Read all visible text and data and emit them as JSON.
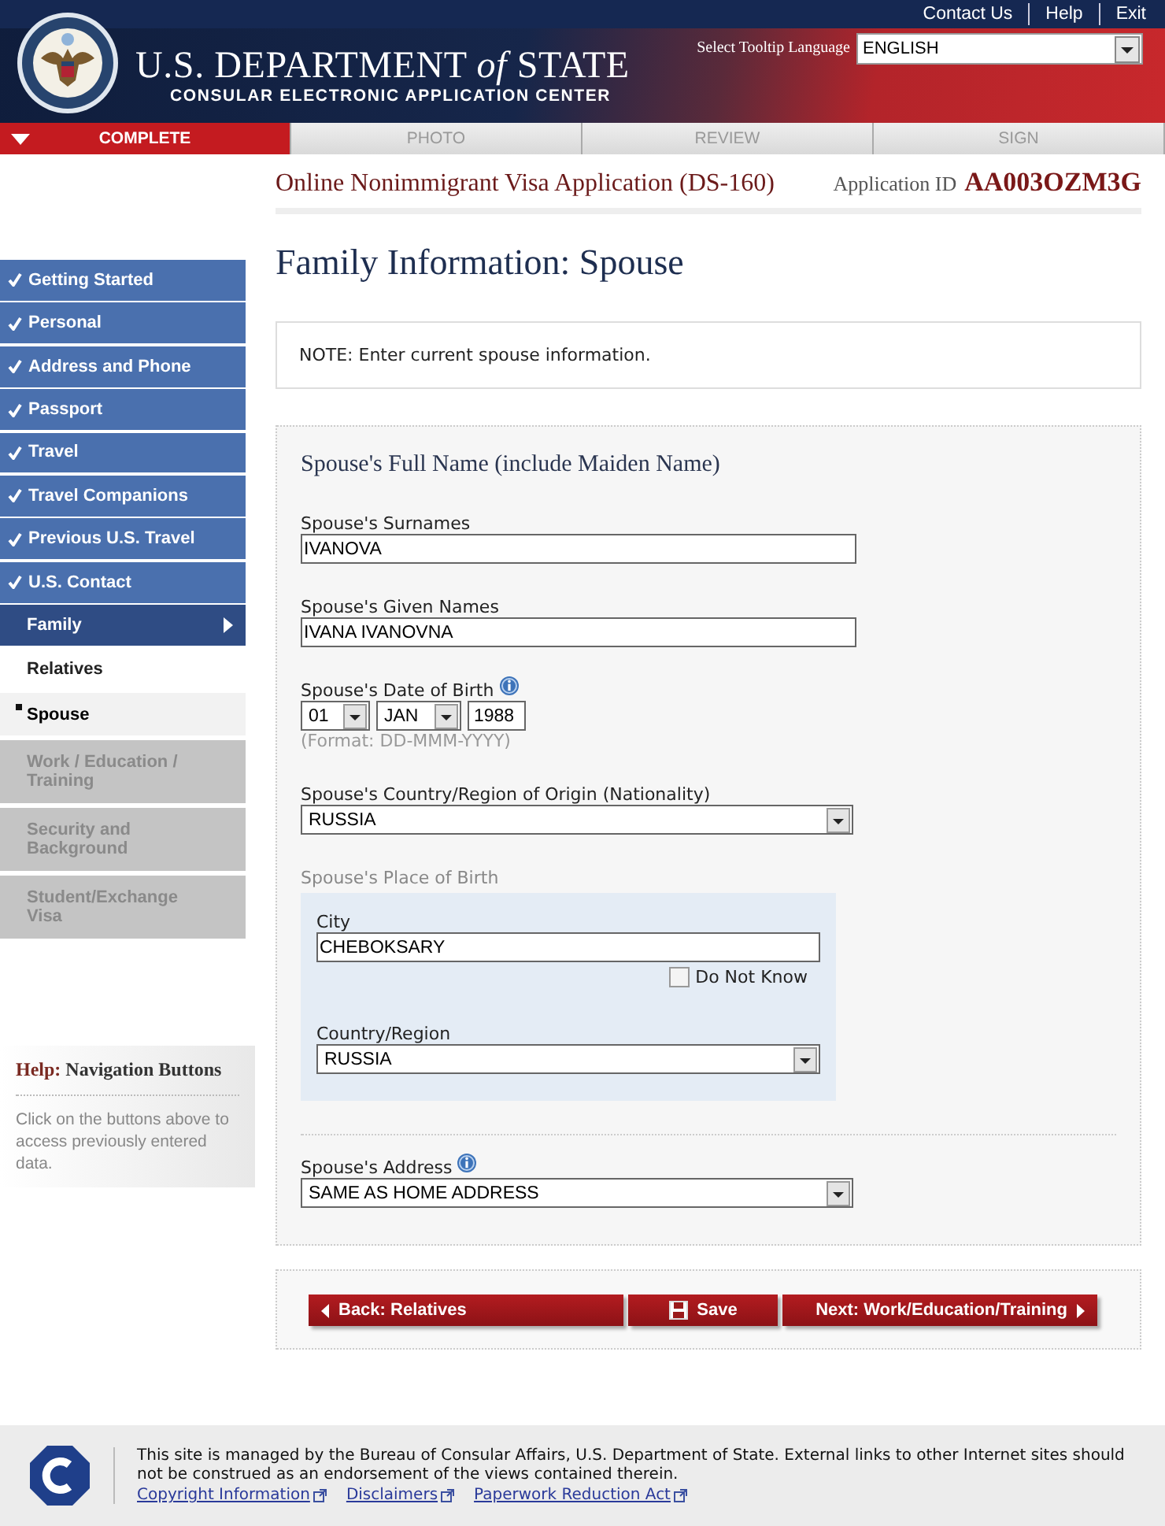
{
  "top_links": [
    {
      "label": "Contact Us"
    },
    {
      "label": "Help"
    },
    {
      "label": "Exit"
    }
  ],
  "header": {
    "title": "U.S. DEPARTMENT *of* STATE",
    "subtitle": "CONSULAR ELECTRONIC APPLICATION CENTER",
    "tooltip_language": {
      "label": "Select Tooltip Language",
      "value": "ENGLISH"
    }
  },
  "progress_tabs": [
    {
      "label": "COMPLETE",
      "selected": true
    },
    {
      "label": "PHOTO",
      "selected": false
    },
    {
      "label": "REVIEW",
      "selected": false
    },
    {
      "label": "SIGN",
      "selected": false
    }
  ],
  "application": {
    "title": "Online Nonimmigrant Visa Application (DS-160)",
    "id_label": "Application ID",
    "id": "AA003OZM3G"
  },
  "sidebar": {
    "items": [
      {
        "label": "Getting Started",
        "kind": "completed",
        "selected": false
      },
      {
        "label": "Personal",
        "kind": "completed",
        "selected": false
      },
      {
        "label": "Address and Phone",
        "kind": "completed",
        "selected": false
      },
      {
        "label": "Passport",
        "kind": "completed",
        "selected": false
      },
      {
        "label": "Travel",
        "kind": "completed",
        "selected": false
      },
      {
        "label": "Travel Companions",
        "kind": "completed",
        "selected": false
      },
      {
        "label": "Previous U.S. Travel",
        "kind": "completed",
        "selected": false
      },
      {
        "label": "U.S. Contact",
        "kind": "completed",
        "selected": false
      },
      {
        "label": "Family",
        "kind": "section",
        "selected": true
      },
      {
        "label": "Relatives",
        "kind": "subsection",
        "selected": false
      },
      {
        "label": "Spouse",
        "kind": "subsection",
        "selected": true
      },
      {
        "label": "Work / Education / Training",
        "kind": "pending",
        "selected": false
      },
      {
        "label": "Security and Background",
        "kind": "pending",
        "selected": false
      },
      {
        "label": "Student/Exchange Visa",
        "kind": "pending",
        "selected": false
      }
    ],
    "help": {
      "prefix": "Help:",
      "title": "Navigation Buttons",
      "text": "Click on the buttons above to access previously entered data."
    }
  },
  "page_title": "Family Information: Spouse",
  "note": "NOTE: Enter current spouse information.",
  "form": {
    "section_title": "Spouse's Full Name (include Maiden Name)",
    "fields": [
      {
        "kind": "text",
        "label": "Spouse's Surnames",
        "value": "IVANOVA"
      },
      {
        "kind": "text",
        "label": "Spouse's Given Names",
        "value": "IVANA IVANOVNA"
      },
      {
        "kind": "date",
        "label": "Spouse's Date of Birth",
        "info": true,
        "day": "01",
        "month": "JAN",
        "year": "1988",
        "hint": "(Format: DD-MMM-YYYY)"
      },
      {
        "kind": "select",
        "label": "Spouse's Country/Region of Origin (Nationality)",
        "info": false,
        "value": "RUSSIA"
      },
      {
        "kind": "group",
        "label": "Spouse's Place of Birth",
        "city_label": "City",
        "city": "CHEBOKSARY",
        "do_not_know": {
          "label": "Do Not Know",
          "checked": false
        },
        "country_label": "Country/Region",
        "country": "RUSSIA"
      },
      {
        "kind": "divider"
      },
      {
        "kind": "select",
        "label": "Spouse's Address",
        "info": true,
        "value": "SAME AS HOME ADDRESS"
      }
    ]
  },
  "buttons": [
    {
      "kind": "back",
      "label": "Back: Relatives"
    },
    {
      "kind": "save",
      "label": "Save"
    },
    {
      "kind": "next",
      "label": "Next: Work/Education/Training"
    }
  ],
  "footer": {
    "text": "This site is managed by the Bureau of Consular Affairs, U.S. Department of State. External links to other Internet sites should not be construed as an endorsement of the views contained therein.",
    "links": [
      "Copyright Information",
      "Disclaimers",
      "Paperwork Reduction Act"
    ]
  }
}
